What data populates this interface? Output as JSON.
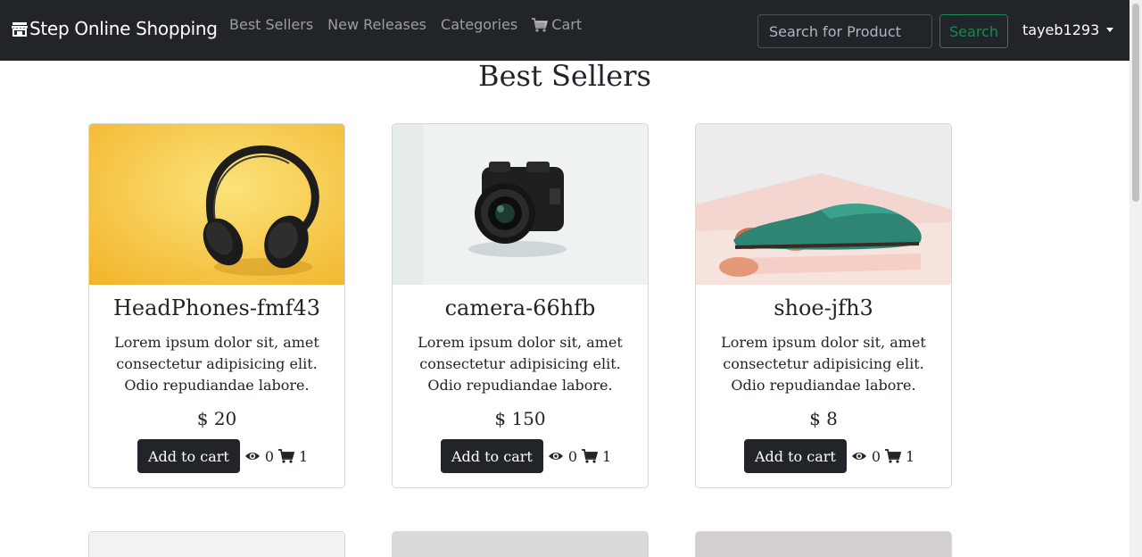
{
  "navbar": {
    "brand": "Step Online Shopping",
    "links": [
      "Best Sellers",
      "New Releases",
      "Categories",
      "Cart"
    ],
    "search_placeholder": "Search for Product",
    "search_button": "Search",
    "username": "tayeb1293"
  },
  "page": {
    "title": "Best Sellers"
  },
  "products": [
    {
      "name": "HeadPhones-fmf43",
      "description": "Lorem ipsum dolor sit, amet consectetur adipisicing elit. Odio repudiandae labore.",
      "price": "$ 20",
      "add_label": "Add to cart",
      "views": "0",
      "cart_count": "1"
    },
    {
      "name": "camera-66hfb",
      "description": "Lorem ipsum dolor sit, amet consectetur adipisicing elit. Odio repudiandae labore.",
      "price": "$ 150",
      "add_label": "Add to cart",
      "views": "0",
      "cart_count": "1"
    },
    {
      "name": "shoe-jfh3",
      "description": "Lorem ipsum dolor sit, amet consectetur adipisicing elit. Odio repudiandae labore.",
      "price": "$ 8",
      "add_label": "Add to cart",
      "views": "0",
      "cart_count": "1"
    }
  ],
  "colors": {
    "navbar_bg": "#212529",
    "search_button_accent": "#198754",
    "button_dark": "#212529"
  },
  "icons": {
    "brand": "shop-icon",
    "cart_nav": "cart-icon",
    "views": "eye-icon",
    "cart_count": "cart-icon"
  }
}
